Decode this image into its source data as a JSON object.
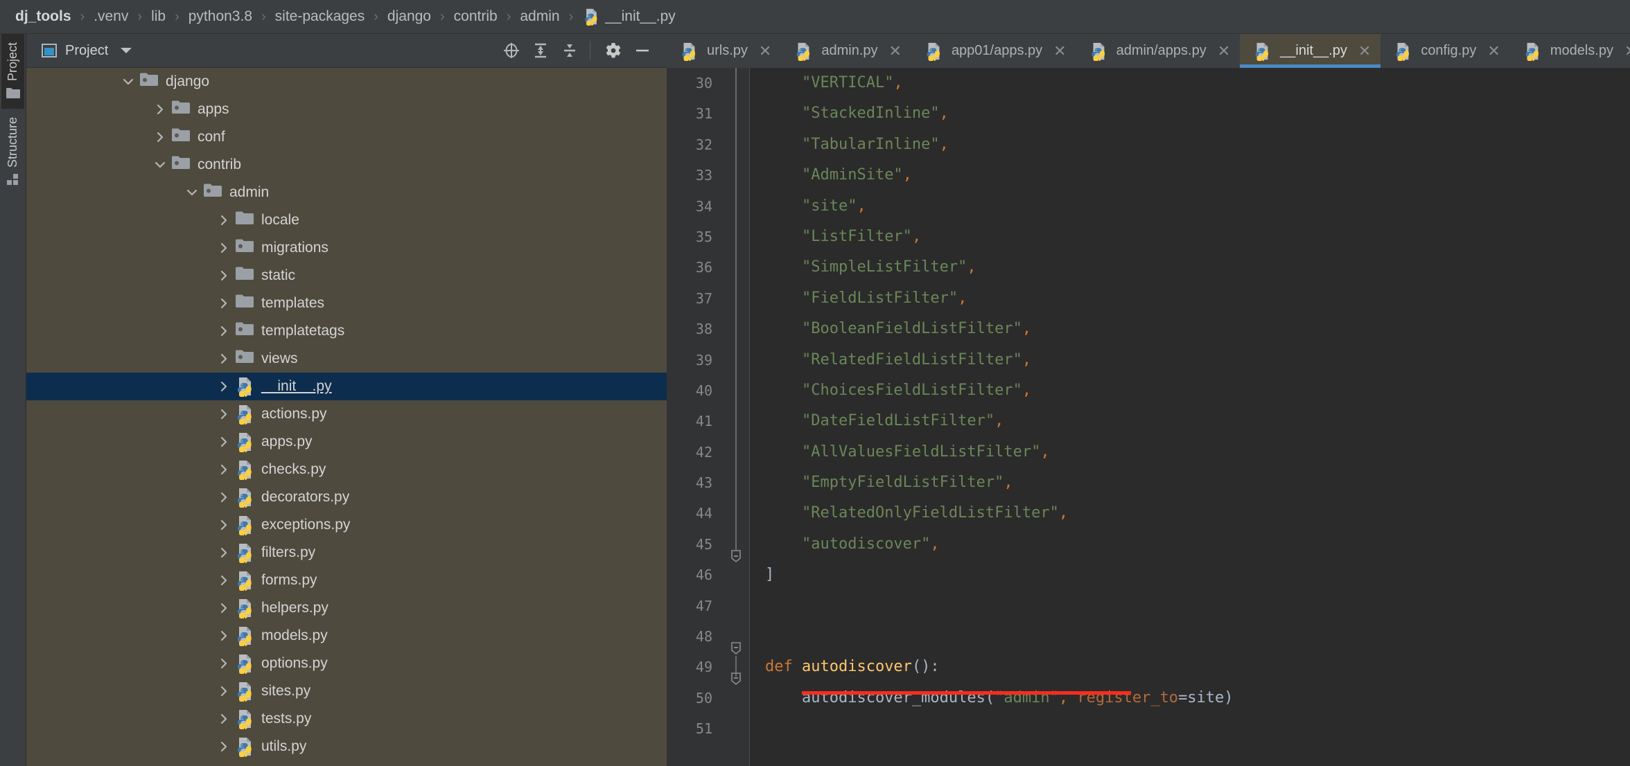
{
  "breadcrumb": {
    "items": [
      {
        "label": "dj_tools",
        "icon": null
      },
      {
        "label": ".venv",
        "icon": null
      },
      {
        "label": "lib",
        "icon": null
      },
      {
        "label": "python3.8",
        "icon": null
      },
      {
        "label": "site-packages",
        "icon": null
      },
      {
        "label": "django",
        "icon": null
      },
      {
        "label": "contrib",
        "icon": null
      },
      {
        "label": "admin",
        "icon": null
      },
      {
        "label": "__init__.py",
        "icon": "python-file-icon"
      }
    ],
    "separator": "›"
  },
  "toolstrip": {
    "tabs": [
      {
        "label": "Project",
        "icon": "folder-icon",
        "active": true
      },
      {
        "label": "Structure",
        "icon": "blocks-icon",
        "active": false
      }
    ]
  },
  "project_panel": {
    "title": "Project",
    "title_icon": "project-window-icon",
    "dropdown_icon": "chevron-down-icon",
    "actions": [
      {
        "name": "select-opened-file-icon",
        "label": "Select Opened File"
      },
      {
        "name": "expand-all-icon",
        "label": "Expand All"
      },
      {
        "name": "collapse-all-icon",
        "label": "Collapse All"
      },
      {
        "name": "gear-icon",
        "label": "Options"
      },
      {
        "name": "hide-icon",
        "label": "Hide"
      }
    ],
    "tree": [
      {
        "label": "django",
        "indent": 2,
        "arrow": "down",
        "icon": "package-folder-icon",
        "selected": false
      },
      {
        "label": "apps",
        "indent": 3,
        "arrow": "right",
        "icon": "package-folder-icon",
        "selected": false
      },
      {
        "label": "conf",
        "indent": 3,
        "arrow": "right",
        "icon": "package-folder-icon",
        "selected": false
      },
      {
        "label": "contrib",
        "indent": 3,
        "arrow": "down",
        "icon": "package-folder-icon",
        "selected": false
      },
      {
        "label": "admin",
        "indent": 4,
        "arrow": "down",
        "icon": "package-folder-icon",
        "selected": false
      },
      {
        "label": "locale",
        "indent": 5,
        "arrow": "right",
        "icon": "folder-icon",
        "selected": false
      },
      {
        "label": "migrations",
        "indent": 5,
        "arrow": "right",
        "icon": "package-folder-icon",
        "selected": false
      },
      {
        "label": "static",
        "indent": 5,
        "arrow": "right",
        "icon": "folder-icon",
        "selected": false
      },
      {
        "label": "templates",
        "indent": 5,
        "arrow": "right",
        "icon": "folder-icon",
        "selected": false
      },
      {
        "label": "templatetags",
        "indent": 5,
        "arrow": "right",
        "icon": "package-folder-icon",
        "selected": false
      },
      {
        "label": "views",
        "indent": 5,
        "arrow": "right",
        "icon": "package-folder-icon",
        "selected": false
      },
      {
        "label": "__init__.py",
        "indent": 5,
        "arrow": "right",
        "icon": "python-file-icon",
        "selected": true
      },
      {
        "label": "actions.py",
        "indent": 5,
        "arrow": "right",
        "icon": "python-file-icon",
        "selected": false
      },
      {
        "label": "apps.py",
        "indent": 5,
        "arrow": "right",
        "icon": "python-file-icon",
        "selected": false
      },
      {
        "label": "checks.py",
        "indent": 5,
        "arrow": "right",
        "icon": "python-file-icon",
        "selected": false
      },
      {
        "label": "decorators.py",
        "indent": 5,
        "arrow": "right",
        "icon": "python-file-icon",
        "selected": false
      },
      {
        "label": "exceptions.py",
        "indent": 5,
        "arrow": "right",
        "icon": "python-file-icon",
        "selected": false
      },
      {
        "label": "filters.py",
        "indent": 5,
        "arrow": "right",
        "icon": "python-file-icon",
        "selected": false
      },
      {
        "label": "forms.py",
        "indent": 5,
        "arrow": "right",
        "icon": "python-file-icon",
        "selected": false
      },
      {
        "label": "helpers.py",
        "indent": 5,
        "arrow": "right",
        "icon": "python-file-icon",
        "selected": false
      },
      {
        "label": "models.py",
        "indent": 5,
        "arrow": "right",
        "icon": "python-file-icon",
        "selected": false
      },
      {
        "label": "options.py",
        "indent": 5,
        "arrow": "right",
        "icon": "python-file-icon",
        "selected": false
      },
      {
        "label": "sites.py",
        "indent": 5,
        "arrow": "right",
        "icon": "python-file-icon",
        "selected": false
      },
      {
        "label": "tests.py",
        "indent": 5,
        "arrow": "right",
        "icon": "python-file-icon",
        "selected": false
      },
      {
        "label": "utils.py",
        "indent": 5,
        "arrow": "right",
        "icon": "python-file-icon",
        "selected": false
      }
    ]
  },
  "editor": {
    "tabs": [
      {
        "label": "urls.py",
        "icon": "python-file-icon",
        "active": false,
        "close": "✕"
      },
      {
        "label": "admin.py",
        "icon": "python-file-icon",
        "active": false,
        "close": "✕"
      },
      {
        "label": "app01/apps.py",
        "icon": "python-file-icon",
        "active": false,
        "close": "✕"
      },
      {
        "label": "admin/apps.py",
        "icon": "python-file-icon",
        "active": false,
        "close": "✕"
      },
      {
        "label": "__init__.py",
        "icon": "python-file-icon",
        "active": true,
        "close": "✕"
      },
      {
        "label": "config.py",
        "icon": "python-file-icon",
        "active": false,
        "close": "✕"
      },
      {
        "label": "models.py",
        "icon": "python-file-icon",
        "active": false,
        "close": "✕"
      }
    ],
    "gutter_numbers": [
      "30",
      "31",
      "32",
      "33",
      "34",
      "35",
      "36",
      "37",
      "38",
      "39",
      "40",
      "41",
      "42",
      "43",
      "44",
      "45",
      "46",
      "47",
      "48",
      "49",
      "50",
      "51"
    ],
    "lines": [
      {
        "n": "30",
        "tokens": [
          {
            "t": "    ",
            "c": "s-txt"
          },
          {
            "t": "\"VERTICAL\"",
            "c": "s-str"
          },
          {
            "t": ",",
            "c": "s-punct"
          }
        ]
      },
      {
        "n": "31",
        "tokens": [
          {
            "t": "    ",
            "c": "s-txt"
          },
          {
            "t": "\"StackedInline\"",
            "c": "s-str"
          },
          {
            "t": ",",
            "c": "s-punct"
          }
        ]
      },
      {
        "n": "32",
        "tokens": [
          {
            "t": "    ",
            "c": "s-txt"
          },
          {
            "t": "\"TabularInline\"",
            "c": "s-str"
          },
          {
            "t": ",",
            "c": "s-punct"
          }
        ]
      },
      {
        "n": "33",
        "tokens": [
          {
            "t": "    ",
            "c": "s-txt"
          },
          {
            "t": "\"AdminSite\"",
            "c": "s-str"
          },
          {
            "t": ",",
            "c": "s-punct"
          }
        ]
      },
      {
        "n": "34",
        "tokens": [
          {
            "t": "    ",
            "c": "s-txt"
          },
          {
            "t": "\"site\"",
            "c": "s-str"
          },
          {
            "t": ",",
            "c": "s-punct"
          }
        ]
      },
      {
        "n": "35",
        "tokens": [
          {
            "t": "    ",
            "c": "s-txt"
          },
          {
            "t": "\"ListFilter\"",
            "c": "s-str"
          },
          {
            "t": ",",
            "c": "s-punct"
          }
        ]
      },
      {
        "n": "36",
        "tokens": [
          {
            "t": "    ",
            "c": "s-txt"
          },
          {
            "t": "\"SimpleListFilter\"",
            "c": "s-str"
          },
          {
            "t": ",",
            "c": "s-punct"
          }
        ]
      },
      {
        "n": "37",
        "tokens": [
          {
            "t": "    ",
            "c": "s-txt"
          },
          {
            "t": "\"FieldListFilter\"",
            "c": "s-str"
          },
          {
            "t": ",",
            "c": "s-punct"
          }
        ]
      },
      {
        "n": "38",
        "tokens": [
          {
            "t": "    ",
            "c": "s-txt"
          },
          {
            "t": "\"BooleanFieldListFilter\"",
            "c": "s-str"
          },
          {
            "t": ",",
            "c": "s-punct"
          }
        ]
      },
      {
        "n": "39",
        "tokens": [
          {
            "t": "    ",
            "c": "s-txt"
          },
          {
            "t": "\"RelatedFieldListFilter\"",
            "c": "s-str"
          },
          {
            "t": ",",
            "c": "s-punct"
          }
        ]
      },
      {
        "n": "40",
        "tokens": [
          {
            "t": "    ",
            "c": "s-txt"
          },
          {
            "t": "\"ChoicesFieldListFilter\"",
            "c": "s-str"
          },
          {
            "t": ",",
            "c": "s-punct"
          }
        ]
      },
      {
        "n": "41",
        "tokens": [
          {
            "t": "    ",
            "c": "s-txt"
          },
          {
            "t": "\"DateFieldListFilter\"",
            "c": "s-str"
          },
          {
            "t": ",",
            "c": "s-punct"
          }
        ]
      },
      {
        "n": "42",
        "tokens": [
          {
            "t": "    ",
            "c": "s-txt"
          },
          {
            "t": "\"AllValuesFieldListFilter\"",
            "c": "s-str"
          },
          {
            "t": ",",
            "c": "s-punct"
          }
        ]
      },
      {
        "n": "43",
        "tokens": [
          {
            "t": "    ",
            "c": "s-txt"
          },
          {
            "t": "\"EmptyFieldListFilter\"",
            "c": "s-str"
          },
          {
            "t": ",",
            "c": "s-punct"
          }
        ]
      },
      {
        "n": "44",
        "tokens": [
          {
            "t": "    ",
            "c": "s-txt"
          },
          {
            "t": "\"RelatedOnlyFieldListFilter\"",
            "c": "s-str"
          },
          {
            "t": ",",
            "c": "s-punct"
          }
        ]
      },
      {
        "n": "45",
        "tokens": [
          {
            "t": "    ",
            "c": "s-txt"
          },
          {
            "t": "\"autodiscover\"",
            "c": "s-str"
          },
          {
            "t": ",",
            "c": "s-punct"
          }
        ]
      },
      {
        "n": "46",
        "tokens": [
          {
            "t": "]",
            "c": "s-bracket"
          }
        ]
      },
      {
        "n": "47",
        "tokens": []
      },
      {
        "n": "48",
        "tokens": []
      },
      {
        "n": "49",
        "tokens": [
          {
            "t": "def ",
            "c": "s-kw"
          },
          {
            "t": "autodiscover",
            "c": "s-fn"
          },
          {
            "t": "():",
            "c": "s-txt"
          }
        ]
      },
      {
        "n": "50",
        "tokens": [
          {
            "t": "    autodiscover_modules(",
            "c": "s-txt"
          },
          {
            "t": "\"admin\"",
            "c": "s-str"
          },
          {
            "t": ", ",
            "c": "s-punct"
          },
          {
            "t": "register_to",
            "c": "s-arg"
          },
          {
            "t": "=site)",
            "c": "s-txt"
          }
        ]
      },
      {
        "n": "51",
        "tokens": []
      }
    ],
    "error_underline": {
      "line": 50,
      "color": "#ff2b1d"
    }
  },
  "colors": {
    "panel_bg": "#3c3f41",
    "tree_bg": "#4e4a3e",
    "editor_bg": "#2b2b2b",
    "gutter_bg": "#313335",
    "selection_bg": "#0d2d4e",
    "active_tab_bg": "#4e4a3e",
    "active_tab_underline": "#4a88c7",
    "string_green": "#6a8759",
    "keyword_orange": "#cc7832",
    "function_yellow": "#ffc66d",
    "error_red": "#ff2b1d"
  }
}
